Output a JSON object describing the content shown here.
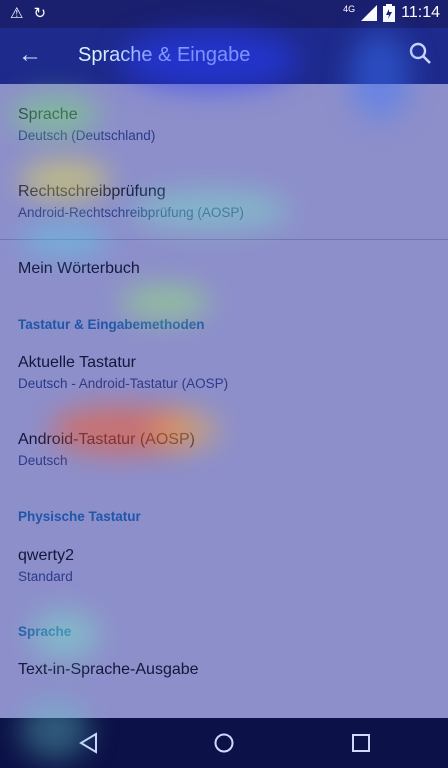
{
  "status_bar": {
    "time": "11:14",
    "network": "4G",
    "icons": [
      "warning-icon",
      "sync-icon",
      "signal-icon",
      "battery-icon"
    ]
  },
  "toolbar": {
    "title": "Sprache & Eingabe",
    "back_icon": "arrow-left-icon",
    "search_icon": "search-icon"
  },
  "list": {
    "language": {
      "title": "Sprache",
      "subtitle": "Deutsch (Deutschland)"
    },
    "spellcheck": {
      "title": "Rechtschreibprüfung",
      "subtitle": "Android-Rechtschreibprüfung (AOSP)"
    },
    "dictionary": {
      "title": "Mein Wörterbuch"
    },
    "header_keyboard": "Tastatur & Eingabemethoden",
    "current_keyboard": {
      "title": "Aktuelle Tastatur",
      "subtitle": "Deutsch - Android-Tastatur (AOSP)"
    },
    "android_keyboard": {
      "title": "Android-Tastatur (AOSP)",
      "subtitle": "Deutsch"
    },
    "header_physical": "Physische Tastatur",
    "qwerty": {
      "title": "qwerty2",
      "subtitle": "Standard"
    },
    "header_speech": "Sprache",
    "tts": {
      "title": "Text-in-Sprache-Ausgabe"
    }
  },
  "nav_bar": {
    "icons": [
      "back-triangle-icon",
      "home-circle-icon",
      "recents-square-icon"
    ]
  },
  "colors": {
    "status_bar": "#1a1f6e",
    "toolbar": "#1e2a8c",
    "background": "#8d8fcb",
    "nav_bar": "#0c1147",
    "section_header": "#1f56a8"
  }
}
